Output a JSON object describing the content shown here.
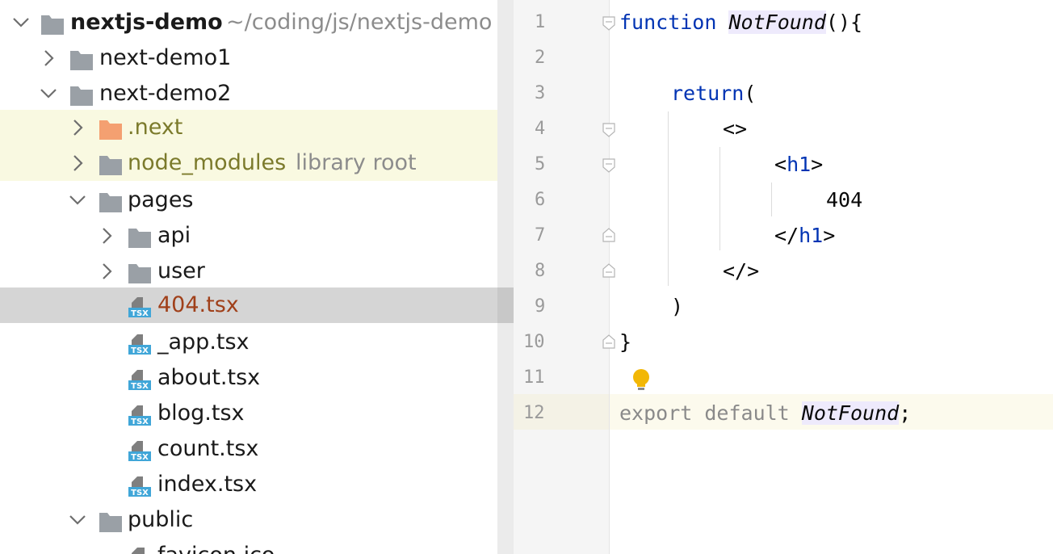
{
  "tree": {
    "root": {
      "name": "nextjs-demo",
      "path": "~/coding/js/nextjs-demo"
    },
    "items": [
      {
        "label": "next-demo1",
        "kind": "folder",
        "state": "collapsed"
      },
      {
        "label": "next-demo2",
        "kind": "folder",
        "state": "expanded"
      },
      {
        "label": ".next",
        "kind": "folder-excluded",
        "state": "collapsed"
      },
      {
        "label": "node_modules",
        "hint": "library root",
        "kind": "folder",
        "state": "collapsed"
      },
      {
        "label": "pages",
        "kind": "folder",
        "state": "expanded"
      },
      {
        "label": "api",
        "kind": "folder",
        "state": "collapsed"
      },
      {
        "label": "user",
        "kind": "folder",
        "state": "collapsed"
      },
      {
        "label": "404.tsx",
        "kind": "tsx-file",
        "selected": true
      },
      {
        "label": "_app.tsx",
        "kind": "tsx-file"
      },
      {
        "label": "about.tsx",
        "kind": "tsx-file"
      },
      {
        "label": "blog.tsx",
        "kind": "tsx-file"
      },
      {
        "label": "count.tsx",
        "kind": "tsx-file"
      },
      {
        "label": "index.tsx",
        "kind": "tsx-file"
      },
      {
        "label": "public",
        "kind": "folder",
        "state": "expanded"
      },
      {
        "label": "favicon.ico",
        "kind": "file"
      }
    ],
    "file_badge": "TSX"
  },
  "editor": {
    "line_numbers": [
      "1",
      "2",
      "3",
      "4",
      "5",
      "6",
      "7",
      "8",
      "9",
      "10",
      "11",
      "12"
    ],
    "current_line": 12,
    "code": {
      "l1_kw": "function",
      "l1_sp": " ",
      "l1_fn": "NotFound",
      "l1_rest": "(){",
      "l3_kw": "return",
      "l3_rest": "(",
      "l4": "<>",
      "l5_open": "<",
      "l5_tag": "h1",
      "l5_close": ">",
      "l6": "404",
      "l7_open": "</",
      "l7_tag": "h1",
      "l7_close": ">",
      "l8": "</>",
      "l9": ")",
      "l10": "}",
      "l12_kw": "export default ",
      "l12_fn": "NotFound",
      "l12_rest": ";"
    }
  },
  "colors": {
    "keyword": "#0033b3",
    "excluded_folder": "#f4a071",
    "folder": "#9aa0a6",
    "tsx_badge": "#40a6d8",
    "selection": "#d5d5d5",
    "library_highlight": "#f9f9e1",
    "bulb": "#f2b705"
  },
  "icons": {
    "chevron_right": "chevron-right-icon",
    "chevron_down": "chevron-down-icon",
    "folder": "folder-icon",
    "tsx_file": "tsx-file-icon",
    "bulb": "lightbulb-icon"
  }
}
